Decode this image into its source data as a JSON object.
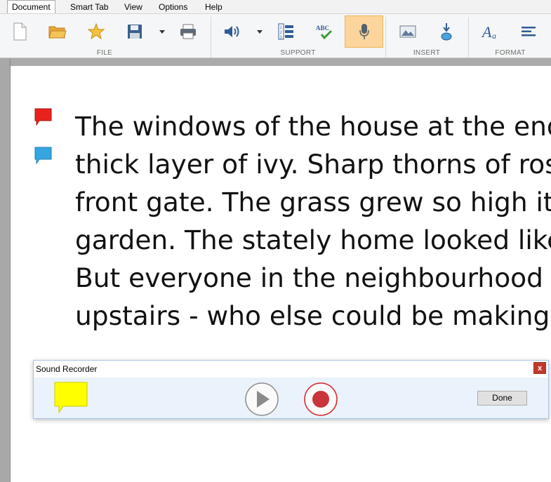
{
  "menubar": {
    "items": [
      {
        "label": "Document",
        "active": true
      },
      {
        "label": "Smart Tab"
      },
      {
        "label": "View"
      },
      {
        "label": "Options"
      },
      {
        "label": "Help"
      }
    ]
  },
  "ribbon": {
    "groups": {
      "file": "FILE",
      "support": "SUPPORT",
      "insert": "INSERT",
      "format": "FORMAT"
    },
    "buttons": {
      "new": "new-document-icon",
      "open": "open-folder-icon",
      "favorites": "star-icon",
      "save": "save-icon",
      "print": "print-icon",
      "speak": "speaker-icon",
      "numbered_list": "numbered-list-icon",
      "spellcheck_label": "ABC",
      "record": "microphone-icon",
      "insert_image": "image-icon",
      "insert_object": "insert-object-icon",
      "font_glyph": "A",
      "font_glyph_small": "a",
      "align": "align-left-icon"
    }
  },
  "document": {
    "lines": [
      "The windows of the house at the end",
      "thick layer of ivy. Sharp thorns of rose",
      "front gate. The grass grew so high it c",
      "garden. The stately home looked like",
      "But everyone in the neighbourhood k",
      "upstairs - who else could be making t"
    ],
    "notes": [
      {
        "color": "#e8231d"
      },
      {
        "color": "#35a6df"
      }
    ]
  },
  "sound_recorder": {
    "title": "Sound Recorder",
    "close_label": "x",
    "done_label": "Done",
    "note_color": "#ffff00",
    "record_color": "#d7242b"
  }
}
